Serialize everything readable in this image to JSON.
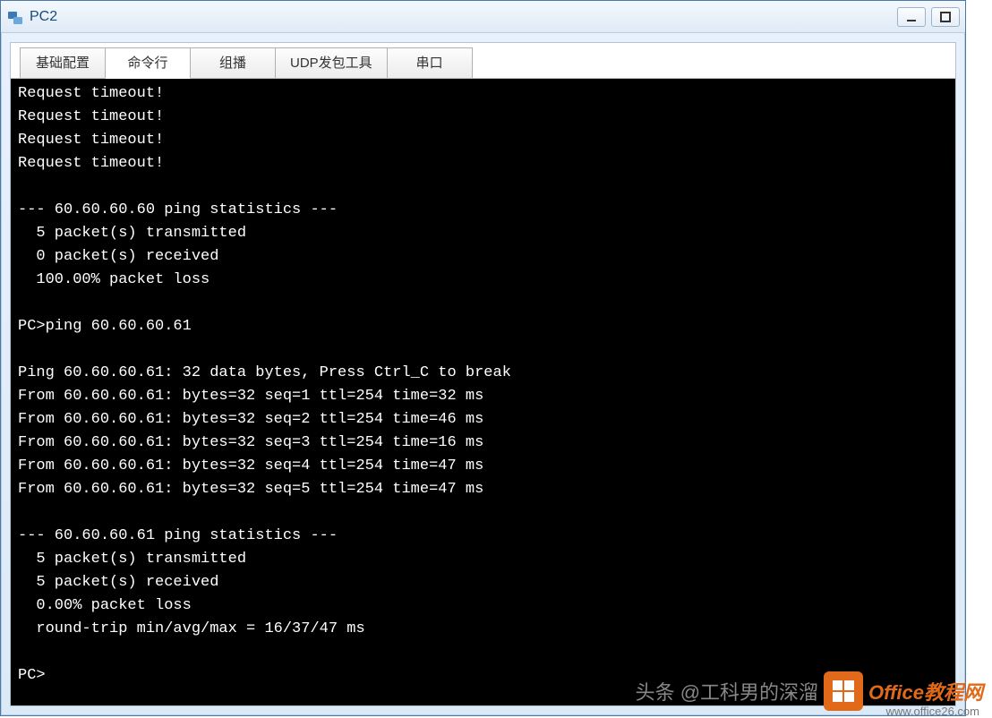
{
  "window": {
    "title": "PC2",
    "icon_name": "app-icon"
  },
  "tabs": [
    {
      "label": "基础配置",
      "active": false
    },
    {
      "label": "命令行",
      "active": true
    },
    {
      "label": "组播",
      "active": false
    },
    {
      "label": "UDP发包工具",
      "active": false
    },
    {
      "label": "串口",
      "active": false
    }
  ],
  "terminal": {
    "lines": [
      "Request timeout!",
      "Request timeout!",
      "Request timeout!",
      "Request timeout!",
      "",
      "--- 60.60.60.60 ping statistics ---",
      "  5 packet(s) transmitted",
      "  0 packet(s) received",
      "  100.00% packet loss",
      "",
      "PC>ping 60.60.60.61",
      "",
      "Ping 60.60.60.61: 32 data bytes, Press Ctrl_C to break",
      "From 60.60.60.61: bytes=32 seq=1 ttl=254 time=32 ms",
      "From 60.60.60.61: bytes=32 seq=2 ttl=254 time=46 ms",
      "From 60.60.60.61: bytes=32 seq=3 ttl=254 time=16 ms",
      "From 60.60.60.61: bytes=32 seq=4 ttl=254 time=47 ms",
      "From 60.60.60.61: bytes=32 seq=5 ttl=254 time=47 ms",
      "",
      "--- 60.60.60.61 ping statistics ---",
      "  5 packet(s) transmitted",
      "  5 packet(s) received",
      "  0.00% packet loss",
      "  round-trip min/avg/max = 16/37/47 ms",
      "",
      "PC>"
    ]
  },
  "watermark": {
    "text1": "头条 @工科男的深溜",
    "logo": "▦",
    "brand": "Office教程网",
    "url": "www.office26.com"
  }
}
